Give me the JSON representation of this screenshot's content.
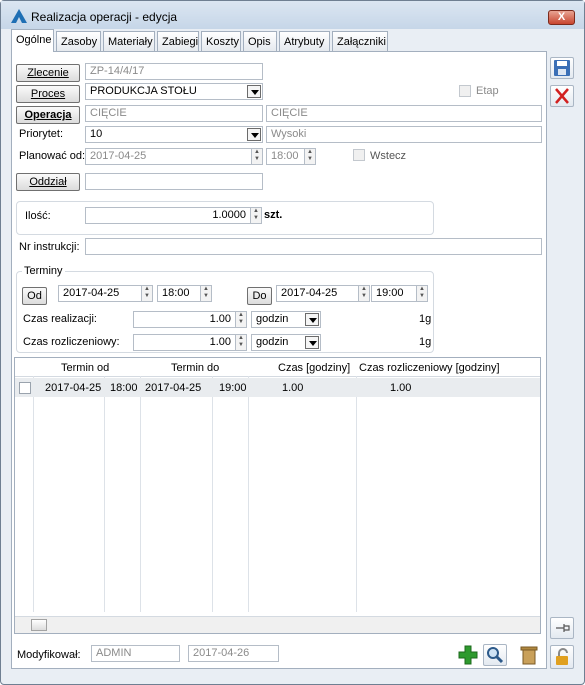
{
  "window": {
    "title": "Realizacja operacji - edycja",
    "close_label": "X"
  },
  "tabs": [
    "Ogólne",
    "Zasoby",
    "Materiały",
    "Zabiegi",
    "Koszty",
    "Opis",
    "Atrybuty",
    "Załączniki"
  ],
  "form": {
    "zlecenie_label": "Zlecenie",
    "zlecenie_value": "ZP-14/4/17",
    "proces_label": "Proces",
    "proces_value": "PRODUKCJA STOŁU",
    "etap_label": "Etap",
    "operacja_label": "Operacja",
    "operacja_code": "CIĘCIE",
    "operacja_name": "CIĘCIE",
    "priorytet_label": "Priorytet:",
    "priorytet_value": "10",
    "priorytet_name": "Wysoki",
    "planowac_label": "Planować od:",
    "planowac_date": "2017-04-25",
    "planowac_time": "18:00",
    "wstecz_label": "Wstecz",
    "oddzial_label": "Oddział",
    "oddzial_value": "",
    "ilosc_label": "Ilość:",
    "ilosc_value": "1.0000",
    "ilosc_unit": "szt.",
    "nr_instrukcji_label": "Nr instrukcji:",
    "nr_instrukcji_value": ""
  },
  "terminy": {
    "title": "Terminy",
    "od_label": "Od",
    "od_date": "2017-04-25",
    "od_time": "18:00",
    "do_label": "Do",
    "do_date": "2017-04-25",
    "do_time": "19:00",
    "czas_realizacji_label": "Czas realizacji:",
    "czas_realizacji_value": "1.00",
    "czas_realizacji_unit": "godzin",
    "czas_realizacji_suffix": "1g",
    "czas_rozliczeniowy_label": "Czas rozliczeniowy:",
    "czas_rozliczeniowy_value": "1.00",
    "czas_rozliczeniowy_unit": "godzin",
    "czas_rozliczeniowy_suffix": "1g"
  },
  "table": {
    "headers": [
      "Termin od",
      "Termin do",
      "Czas [godziny]",
      "Czas rozliczeniowy [godziny]"
    ],
    "rows": [
      {
        "od_date": "2017-04-25",
        "od_time": "18:00",
        "do_date": "2017-04-25",
        "do_time": "19:00",
        "czas": "1.00",
        "czas_rozl": "1.00"
      }
    ]
  },
  "footer": {
    "modyfikowal_label": "Modyfikował:",
    "modyfikowal_user": "ADMIN",
    "modyfikowal_date": "2017-04-26"
  },
  "colors": {
    "accent": "#1f6fb4",
    "add_green": "#2e9a2e",
    "delete_red": "#d22020"
  }
}
